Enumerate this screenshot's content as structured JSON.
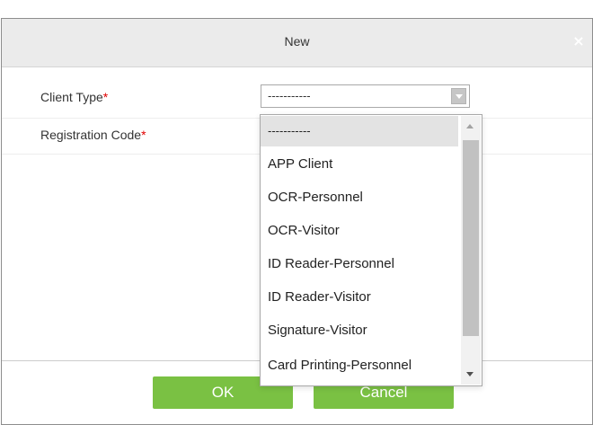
{
  "dialog": {
    "title": "New",
    "close_symbol": "×",
    "close_icon": "close-icon"
  },
  "form": {
    "client_type": {
      "label": "Client Type",
      "required_mark": "*",
      "value": "-----------"
    },
    "registration_code": {
      "label": "Registration Code",
      "required_mark": "*"
    }
  },
  "dropdown": {
    "options": [
      "-----------",
      "APP Client",
      "OCR-Personnel",
      "OCR-Visitor",
      "ID Reader-Personnel",
      "ID Reader-Visitor",
      "Signature-Visitor",
      "Card Printing-Personnel"
    ],
    "selected_index": 0
  },
  "buttons": {
    "ok_label": "OK",
    "cancel_label": "Cancel"
  },
  "colors": {
    "button_green": "#7ac143",
    "required_red": "#e10000",
    "title_bar": "#ebebeb",
    "option_highlight": "#e3e3e3"
  }
}
